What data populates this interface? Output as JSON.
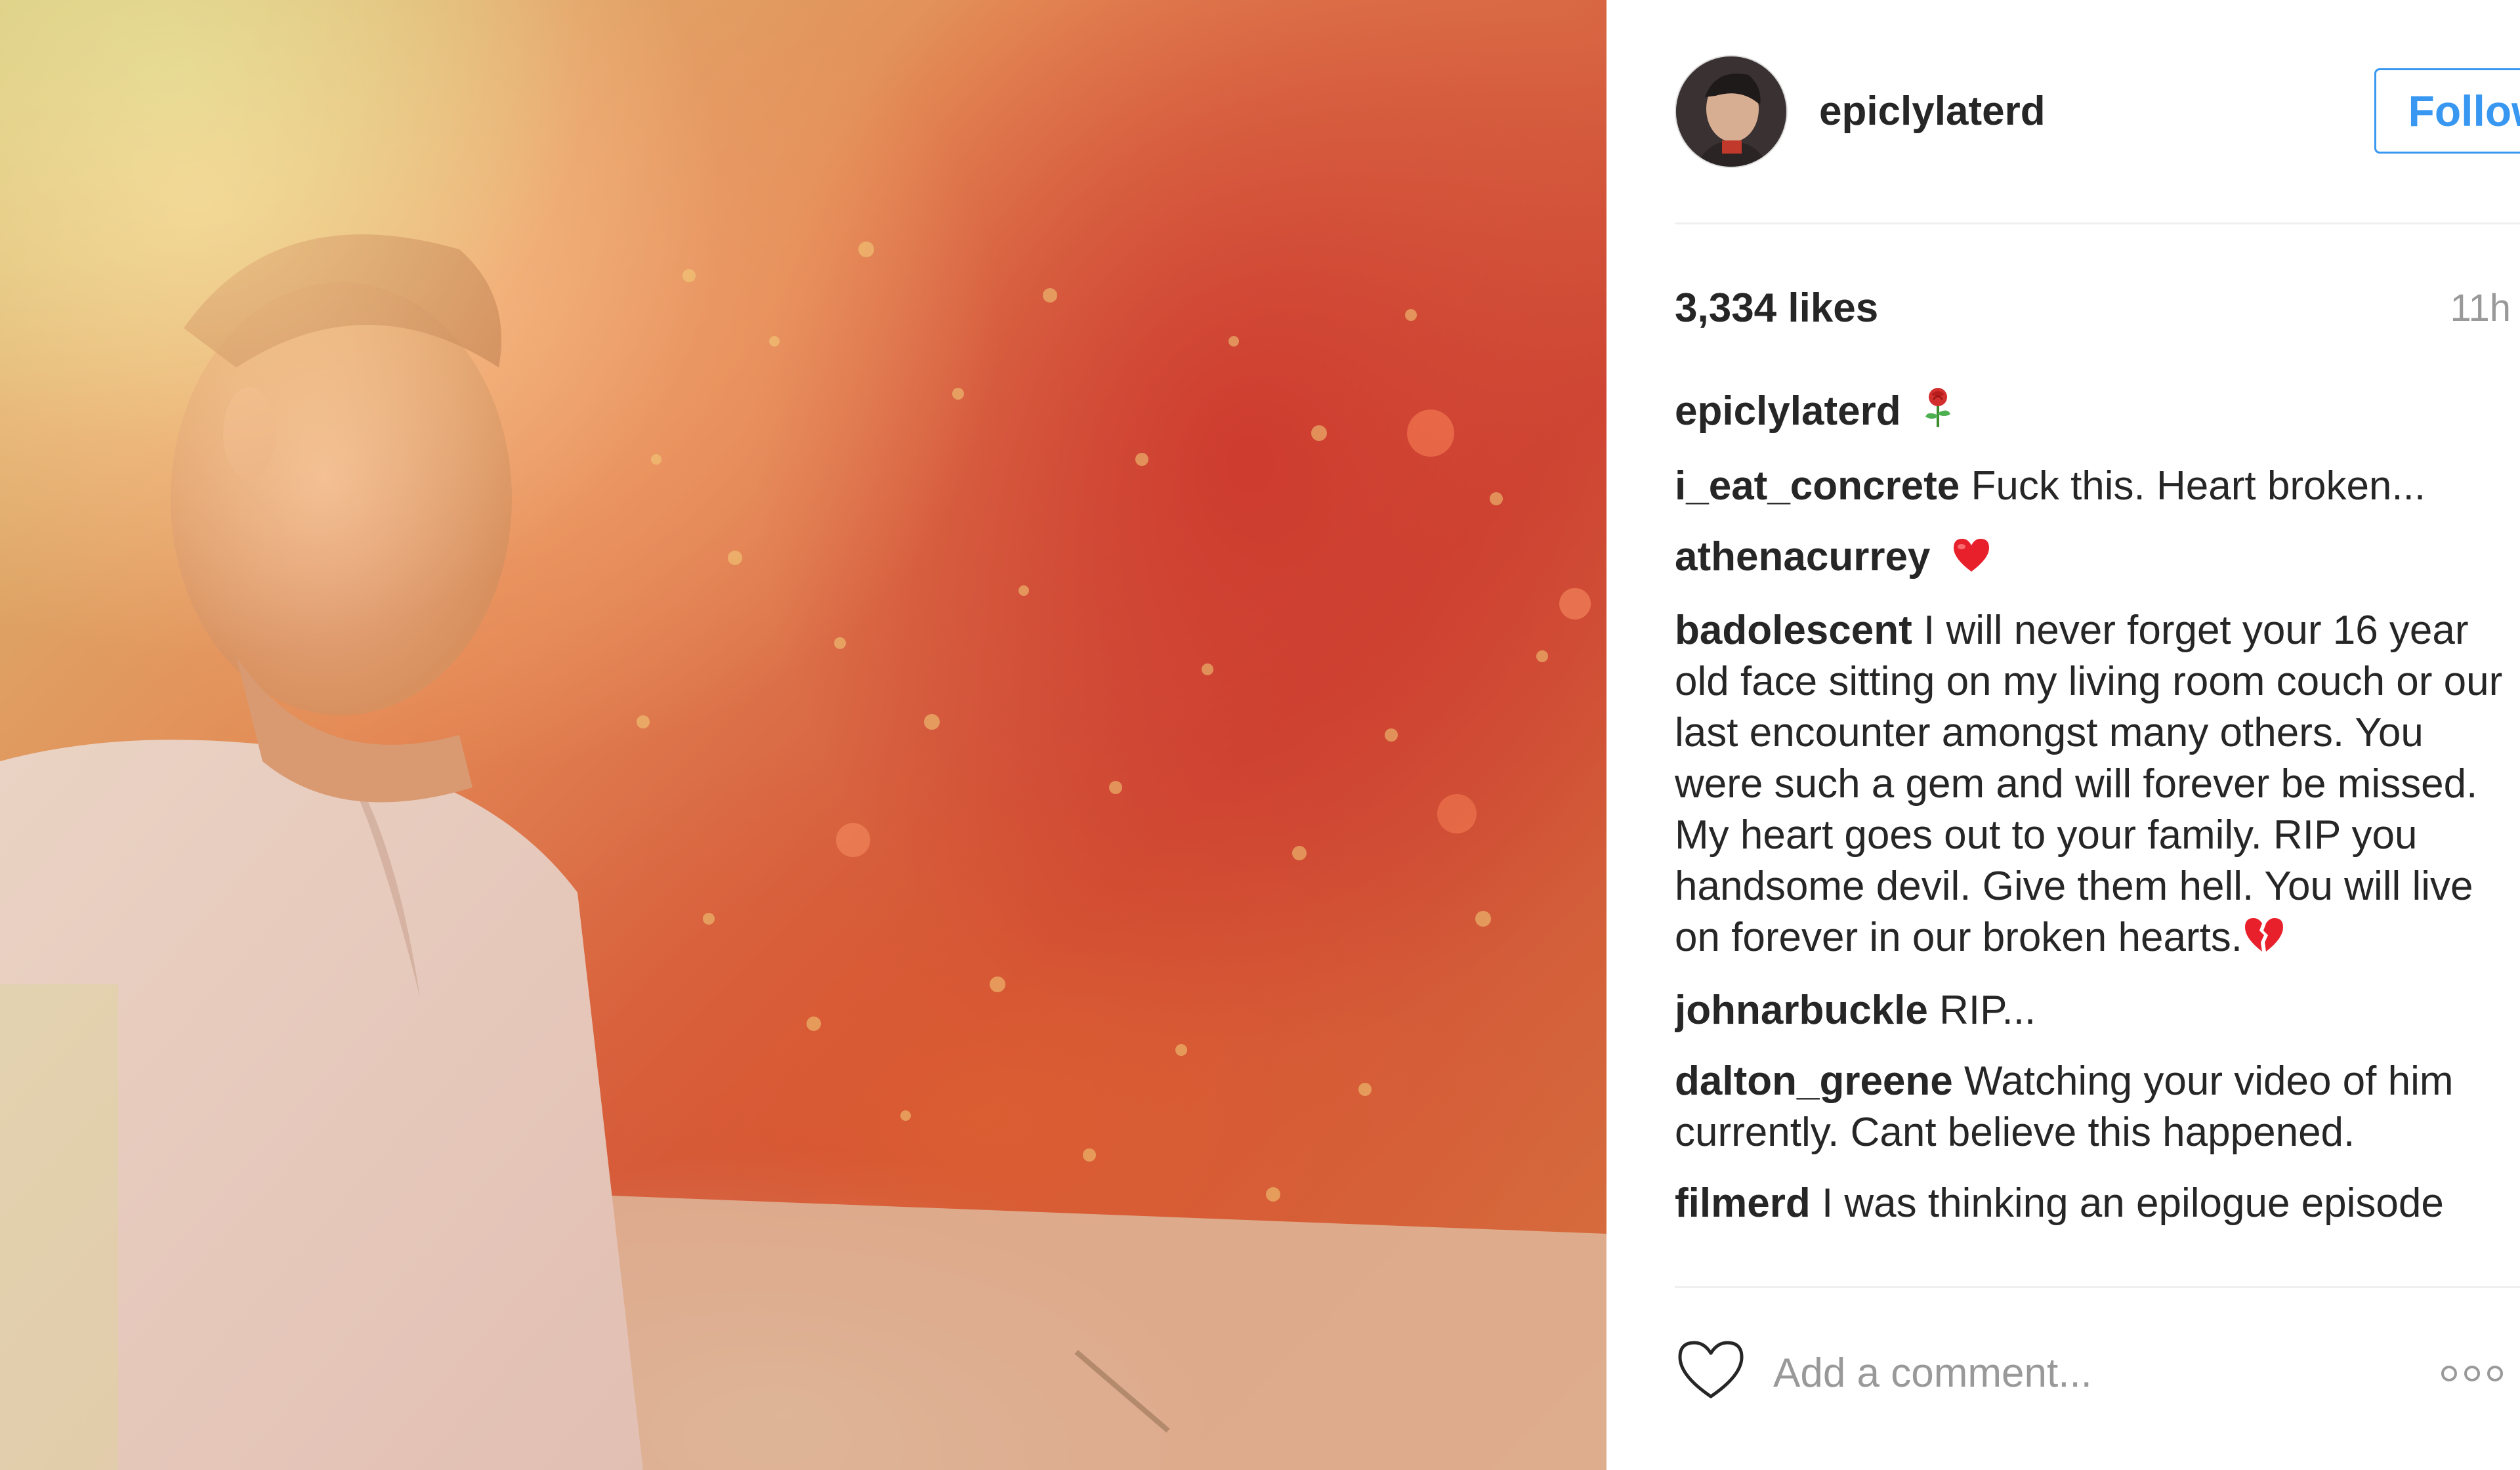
{
  "post": {
    "username": "epiclylaterd",
    "follow_label": "Follow",
    "likes": "3,334 likes",
    "time": "11h",
    "add_comment_placeholder": "Add a comment..."
  },
  "comments": [
    {
      "user": "epiclylaterd",
      "text": "",
      "emoji": "rose-icon"
    },
    {
      "user": "i_eat_concrete",
      "text": "Fuck this. Heart broken..."
    },
    {
      "user": "athenacurrey",
      "text": "",
      "emoji": "heart-icon"
    },
    {
      "user": "badolescent",
      "text": "I will never forget your 16 year old face sitting on my living room couch or our last encounter amongst many others. You were such a gem and will forever be missed. My heart goes out to your family. RIP you handsome devil. Give them hell. You will live on forever in our broken hearts.",
      "emoji": "broken-heart-icon"
    },
    {
      "user": "johnarbuckle",
      "text": "RIP..."
    },
    {
      "user": "dalton_greene",
      "text": "Watching your video of him currently. Cant believe this happened."
    },
    {
      "user": "filmerd",
      "text": "I was thinking an epilogue episode"
    }
  ],
  "colors": {
    "accent": "#3897f0",
    "text": "#262626",
    "muted": "#999999",
    "divider": "#efefef"
  }
}
